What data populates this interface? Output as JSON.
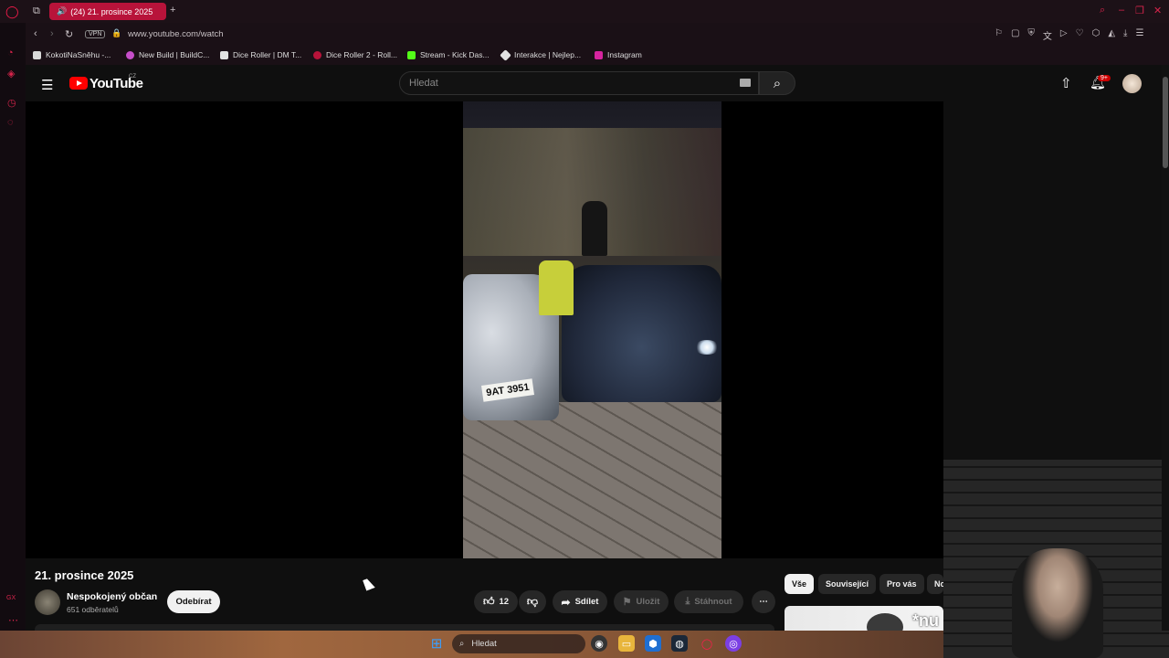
{
  "browser": {
    "tab_title": "(24) 21. prosince 2025",
    "url": "www.youtube.com/watch",
    "vpn_label": "VPN",
    "bookmarks": [
      {
        "label": "KokotiNaSněhu -...",
        "color": "#d9d9d9"
      },
      {
        "label": "New Build | BuildC...",
        "color": "#c64ec9"
      },
      {
        "label": "Dice Roller | DM T...",
        "color": "#e2e2e2"
      },
      {
        "label": "Dice Roller 2 - Roll...",
        "color": "#b8133a"
      },
      {
        "label": "Stream - Kick Das...",
        "color": "#53fc18"
      },
      {
        "label": "Interakce | Nejlep...",
        "color": "#e2e2e2"
      },
      {
        "label": "Instagram",
        "color": "#d6249f"
      }
    ]
  },
  "youtube": {
    "logo_text": "YouTube",
    "country": "CZ",
    "search_placeholder": "Hledat",
    "notification_count": "9+"
  },
  "video": {
    "plate_text": "9AT 3951",
    "title": "21. prosince 2025",
    "channel": "Nespokojený občan",
    "subscribers": "651 odběratelů",
    "subscribe_label": "Odebírat",
    "like_count": "12",
    "share_label": "Sdílet",
    "save_label": "Uložit",
    "download_label": "Stáhnout"
  },
  "chips": [
    "Vše",
    "Související",
    "Pro vás",
    "No"
  ],
  "thumbnail_text": "*nu",
  "taskbar": {
    "search_label": "Hledat"
  }
}
